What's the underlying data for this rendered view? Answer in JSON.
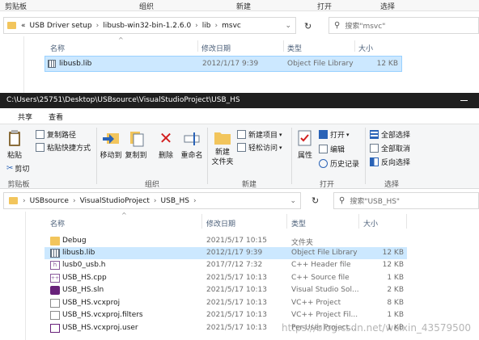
{
  "back_window": {
    "ribbon_groups": [
      "剪贴板",
      "组织",
      "新建",
      "打开",
      "选择"
    ],
    "breadcrumb": [
      "«",
      "USB Driver setup",
      "libusb-win32-bin-1.2.6.0",
      "lib",
      "msvc"
    ],
    "search_placeholder": "搜索\"msvc\"",
    "columns": [
      "名称",
      "修改日期",
      "类型",
      "大小"
    ],
    "files": [
      {
        "name": "libusb.lib",
        "date": "2012/1/17 9:39",
        "type": "Object File Library",
        "size": "12 KB",
        "icon": "library-file-icon"
      }
    ]
  },
  "front_window": {
    "title": "C:\\Users\\25751\\Desktop\\USBsource\\VisualStudioProject\\USB_HS",
    "tabs": [
      "共享",
      "查看"
    ],
    "ribbon": {
      "clipboard": {
        "paste": "粘贴",
        "copy_path": "复制路径",
        "paste_shortcut": "粘贴快捷方式",
        "cut": "剪切",
        "group": "剪贴板"
      },
      "organize": {
        "move_to": "移动到",
        "copy_to": "复制到",
        "delete": "删除",
        "rename": "重命名",
        "group": "组织"
      },
      "new": {
        "new_folder": "新建\n文件夹",
        "new_item": "新建项目",
        "easy_access": "轻松访问",
        "group": "新建"
      },
      "open": {
        "properties": "属性",
        "open": "打开",
        "edit": "编辑",
        "history": "历史记录",
        "group": "打开"
      },
      "select": {
        "select_all": "全部选择",
        "select_none": "全部取消",
        "invert": "反向选择",
        "group": "选择"
      }
    },
    "breadcrumb": [
      "USBsource",
      "VisualStudioProject",
      "USB_HS"
    ],
    "search_placeholder": "搜索\"USB_HS\"",
    "columns": [
      "名称",
      "修改日期",
      "类型",
      "大小"
    ],
    "files": [
      {
        "name": "Debug",
        "date": "2021/5/17 10:15",
        "type": "文件夹",
        "size": "",
        "icon": "folder-icon",
        "selected": false
      },
      {
        "name": "libusb.lib",
        "date": "2012/1/17 9:39",
        "type": "Object File Library",
        "size": "12 KB",
        "icon": "library-file-icon",
        "selected": true
      },
      {
        "name": "lusb0_usb.h",
        "date": "2017/7/12 7:32",
        "type": "C++ Header file",
        "size": "12 KB",
        "icon": "header-file-icon",
        "selected": false
      },
      {
        "name": "USB_HS.cpp",
        "date": "2021/5/17 10:13",
        "type": "C++ Source file",
        "size": "1 KB",
        "icon": "cpp-file-icon",
        "selected": false
      },
      {
        "name": "USB_HS.sln",
        "date": "2021/5/17 10:13",
        "type": "Visual Studio Sol...",
        "size": "2 KB",
        "icon": "solution-file-icon",
        "selected": false
      },
      {
        "name": "USB_HS.vcxproj",
        "date": "2021/5/17 10:13",
        "type": "VC++ Project",
        "size": "8 KB",
        "icon": "document-icon",
        "selected": false
      },
      {
        "name": "USB_HS.vcxproj.filters",
        "date": "2021/5/17 10:13",
        "type": "VC++ Project Fil...",
        "size": "1 KB",
        "icon": "document-icon",
        "selected": false
      },
      {
        "name": "USB_HS.vcxproj.user",
        "date": "2021/5/17 10:13",
        "type": "Per-User Project...",
        "size": "1 KB",
        "icon": "user-file-icon",
        "selected": false
      }
    ]
  },
  "watermark": "https://blog.csdn.net/weixin_43579500",
  "colors": {
    "selection": "#cce8ff",
    "titlebar": "#1f1f1f",
    "ribbon": "#f5f6f7",
    "header_text": "#4c607a"
  }
}
